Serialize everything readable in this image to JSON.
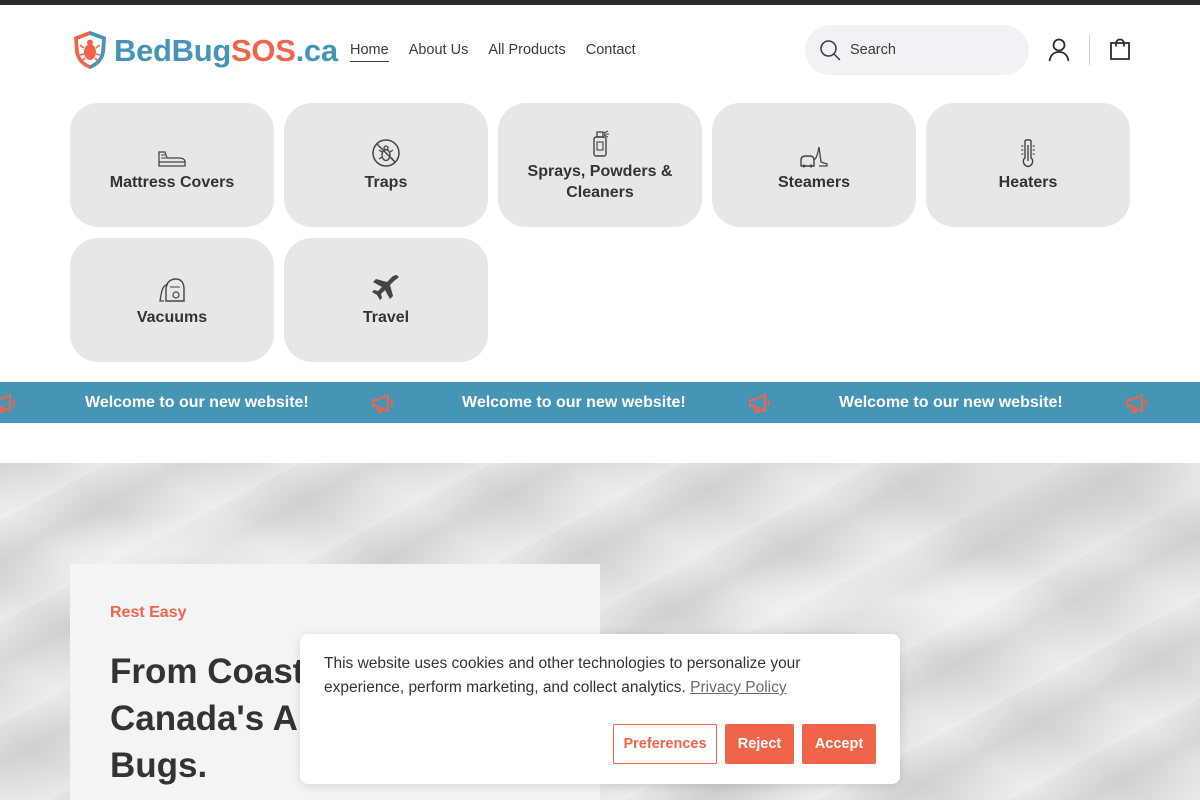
{
  "brand": {
    "logo_text_a": "BedBug",
    "logo_text_b": "SOS",
    "logo_text_c": ".ca",
    "colors": {
      "blue": "#4795b6",
      "coral": "#f06449",
      "tile": "#e7e7e7",
      "dark": "#2b2b2b"
    }
  },
  "nav": {
    "items": [
      {
        "label": "Home",
        "active": true
      },
      {
        "label": "About Us",
        "active": false
      },
      {
        "label": "All Products",
        "active": false
      },
      {
        "label": "Contact",
        "active": false
      }
    ]
  },
  "search": {
    "placeholder": "Search",
    "icon": "search-icon"
  },
  "header_icons": {
    "account": "account-icon",
    "cart": "cart-icon"
  },
  "categories": [
    {
      "label": "Mattress Covers",
      "icon": "mattress-icon"
    },
    {
      "label": "Traps",
      "icon": "bug-trap-icon"
    },
    {
      "label": "Sprays, Powders & Cleaners",
      "icon": "spray-can-icon"
    },
    {
      "label": "Steamers",
      "icon": "steamer-icon"
    },
    {
      "label": "Heaters",
      "icon": "thermometer-icon"
    },
    {
      "label": "Vacuums",
      "icon": "vacuum-icon"
    },
    {
      "label": "Travel",
      "icon": "airplane-icon"
    }
  ],
  "announcement": {
    "text": "Welcome to our new website!",
    "icon": "megaphone-icon"
  },
  "hero": {
    "eyebrow": "Rest Easy",
    "title": "From Coast to Coast, Canada's Answer to Bed Bugs."
  },
  "cookie_banner": {
    "text": "This website uses cookies and other technologies to personalize your experience, perform marketing, and collect analytics.",
    "link": "Privacy Policy",
    "buttons": {
      "preferences": "Preferences",
      "reject": "Reject",
      "accept": "Accept"
    }
  }
}
